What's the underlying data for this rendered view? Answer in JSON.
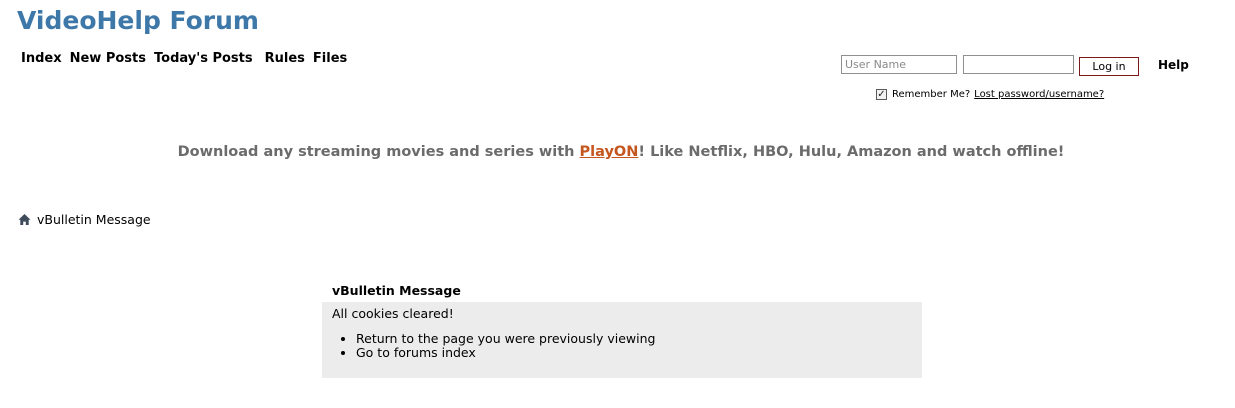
{
  "header": {
    "site_title": "VideoHelp Forum",
    "nav": {
      "index": "Index",
      "new_posts": "New Posts",
      "todays_posts": "Today's Posts",
      "rules": "Rules",
      "files": "Files"
    }
  },
  "login": {
    "username_placeholder": "User Name",
    "username_value": "",
    "password_value": "",
    "login_button": "Log in",
    "help_link": "Help",
    "remember_me_label": "Remember Me?",
    "remember_me_checked": true,
    "lost_password_link": "Lost password/username?"
  },
  "promo": {
    "text_before": "Download any streaming movies and series with ",
    "link_text": "PlayON",
    "text_after": "! Like Netflix, HBO, Hulu, Amazon and watch offline!"
  },
  "breadcrumb": {
    "icon": "home-icon",
    "label": "vBulletin Message"
  },
  "message": {
    "title": "vBulletin Message",
    "text": "All cookies cleared!",
    "links": [
      "Return to the page you were previously viewing",
      "Go to forums index"
    ]
  },
  "colors": {
    "title": "#3e78a8",
    "promo_text": "#6b6b6b",
    "promo_link": "#c4561e",
    "message_bg": "#ececec",
    "login_button_border": "#7a1b1b"
  }
}
